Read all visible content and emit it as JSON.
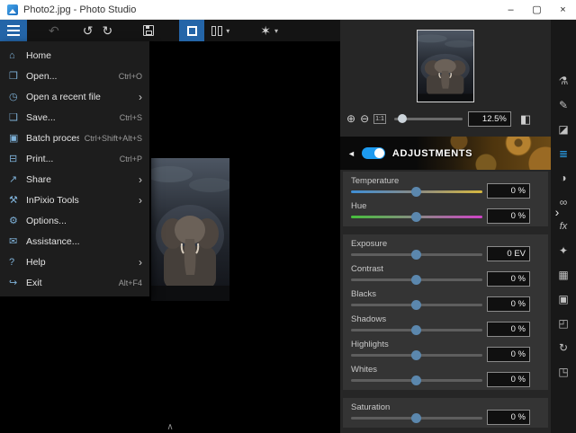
{
  "window": {
    "title": "Photo2.jpg - Photo Studio",
    "controls": [
      {
        "name": "minimize",
        "glyph": "–"
      },
      {
        "name": "maximize",
        "glyph": "▢"
      },
      {
        "name": "close",
        "glyph": "×"
      }
    ]
  },
  "toolbar": {
    "buttons": [
      {
        "name": "main-menu",
        "icon": "hamburger-icon",
        "active": true
      },
      {
        "name": "undo",
        "icon": "undo-icon",
        "glyph": "↶",
        "disabled": true
      },
      {
        "name": "rotate-left",
        "icon": "rotate-left-icon",
        "glyph": "↺"
      },
      {
        "name": "rotate-right",
        "icon": "rotate-right-icon",
        "glyph": "↻"
      },
      {
        "name": "save",
        "icon": "save-icon"
      },
      {
        "name": "view-single",
        "icon": "single-view-icon",
        "active": true
      },
      {
        "name": "view-compare",
        "icon": "split-view-icon",
        "dropdown": true
      },
      {
        "name": "retouch-tools",
        "icon": "magic-wand-icon",
        "glyph": "✶",
        "dropdown": true
      }
    ]
  },
  "menu": {
    "submenu_arrow": "›",
    "items": [
      {
        "label": "Home",
        "icon": "home-icon",
        "glyph": "⌂"
      },
      {
        "label": "Open...",
        "icon": "open-folder-icon",
        "glyph": "❒",
        "shortcut": "Ctrl+O"
      },
      {
        "label": "Open a recent file",
        "icon": "recent-file-icon",
        "glyph": "◷",
        "submenu": true
      },
      {
        "label": "Save...",
        "icon": "save-file-icon",
        "glyph": "❑",
        "shortcut": "Ctrl+S"
      },
      {
        "label": "Batch process...",
        "icon": "batch-process-icon",
        "glyph": "▣",
        "shortcut": "Ctrl+Shift+Alt+S"
      },
      {
        "label": "Print...",
        "icon": "print-icon",
        "glyph": "⊟",
        "shortcut": "Ctrl+P"
      },
      {
        "label": "Share",
        "icon": "share-icon",
        "glyph": "↗",
        "submenu": true
      },
      {
        "label": "InPixio Tools",
        "icon": "tools-icon",
        "glyph": "⚒",
        "submenu": true
      },
      {
        "label": "Options...",
        "icon": "options-gear-icon",
        "glyph": "⚙"
      },
      {
        "label": "Assistance...",
        "icon": "assistance-icon",
        "glyph": "✉"
      },
      {
        "label": "Help",
        "icon": "help-icon",
        "glyph": "?",
        "submenu": true
      },
      {
        "label": "Exit",
        "icon": "exit-icon",
        "glyph": "↪",
        "shortcut": "Alt+F4"
      }
    ]
  },
  "preview": {
    "zoom": {
      "icons": [
        {
          "name": "zoom-in-icon",
          "glyph": "⊕"
        },
        {
          "name": "zoom-out-icon",
          "glyph": "⊖"
        },
        {
          "name": "zoom-actual-size-icon",
          "glyph": "1:1"
        }
      ],
      "value": "12.5%",
      "slider_percent": 12.5,
      "fit_icon": "◧"
    }
  },
  "adjustments": {
    "collapse_arrow": "◄",
    "title": "ADJUSTMENTS",
    "toggle_on": true,
    "groups": [
      {
        "sliders": [
          {
            "label": "Temperature",
            "value": "0 %",
            "track": "temperature"
          },
          {
            "label": "Hue",
            "value": "0 %",
            "track": "hue"
          }
        ]
      },
      {
        "sliders": [
          {
            "label": "Exposure",
            "value": "0 EV",
            "track": "plain"
          },
          {
            "label": "Contrast",
            "value": "0 %",
            "track": "plain"
          },
          {
            "label": "Blacks",
            "value": "0 %",
            "track": "plain"
          },
          {
            "label": "Shadows",
            "value": "0 %",
            "track": "plain"
          },
          {
            "label": "Highlights",
            "value": "0 %",
            "track": "plain"
          },
          {
            "label": "Whites",
            "value": "0 %",
            "track": "plain"
          }
        ]
      },
      {
        "sliders": [
          {
            "label": "Saturation",
            "value": "0 %",
            "track": "plain"
          }
        ]
      }
    ]
  },
  "rail": {
    "expand_arrow": "›",
    "icons": [
      {
        "name": "color-lab-icon",
        "glyph": "⚗"
      },
      {
        "name": "pencil-icon",
        "glyph": "✎"
      },
      {
        "name": "eraser-icon",
        "glyph": "◪"
      },
      {
        "name": "adjustments-icon",
        "glyph": "≣",
        "active": true
      },
      {
        "name": "tone-curve-icon",
        "glyph": "◑"
      },
      {
        "name": "glasses-icon",
        "glyph": "∞"
      },
      {
        "name": "effects-fx-icon",
        "glyph": "fx"
      },
      {
        "name": "magic-wand-icon",
        "glyph": "✦"
      },
      {
        "name": "grid-icon",
        "glyph": "▦"
      },
      {
        "name": "frames-icon",
        "glyph": "▣"
      },
      {
        "name": "crop-icon",
        "glyph": "◰"
      },
      {
        "name": "rotate-icon",
        "glyph": "↻"
      },
      {
        "name": "resize-icon",
        "glyph": "◳"
      }
    ]
  },
  "canvas": {
    "bottom_expander": "∧"
  },
  "colors": {
    "accent": "#1d9bf0",
    "toolbar_active": "#2465a8",
    "slider_handle": "#5b87ad",
    "temperature_left": "#3f8fd6",
    "temperature_right": "#d6b83f",
    "hue_left": "#46c03c",
    "hue_right": "#d043c8"
  }
}
